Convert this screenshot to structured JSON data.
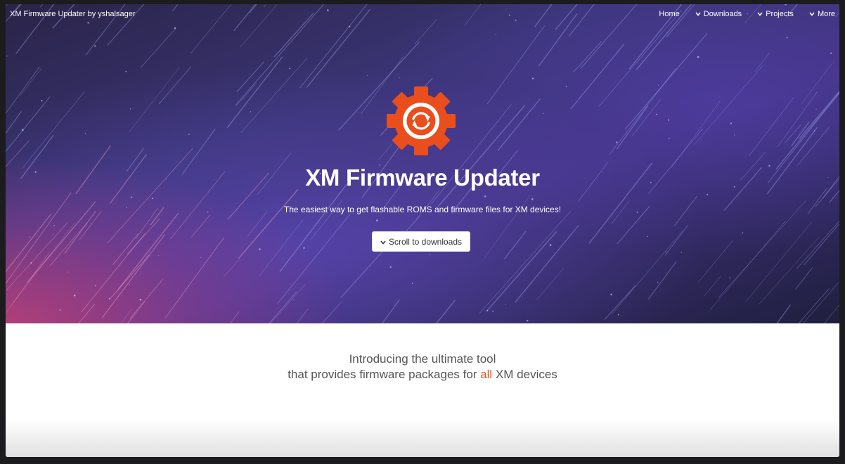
{
  "navbar": {
    "brand": "XM Firmware Updater by yshalsager",
    "items": [
      {
        "label": "Home",
        "icon": ""
      },
      {
        "label": "Downloads",
        "icon": "chevron-down-icon"
      },
      {
        "label": "Projects",
        "icon": "chevron-down-icon"
      },
      {
        "label": "More",
        "icon": "chevron-down-icon"
      }
    ]
  },
  "hero": {
    "logo_icon": "gear-refresh-icon",
    "title": "XM Firmware Updater",
    "subtitle": "The easiest way to get flashable ROMS and firmware files for XM devices!",
    "button_label": "Scroll to downloads",
    "button_icon": "chevron-down-icon"
  },
  "intro": {
    "line1": "Introducing the ultimate tool",
    "line2_before": "that provides firmware packages for ",
    "line2_highlight": "all",
    "line2_after": " XM devices"
  },
  "colors": {
    "accent": "#e8531f",
    "logo_orange": "#ea4e1d"
  }
}
